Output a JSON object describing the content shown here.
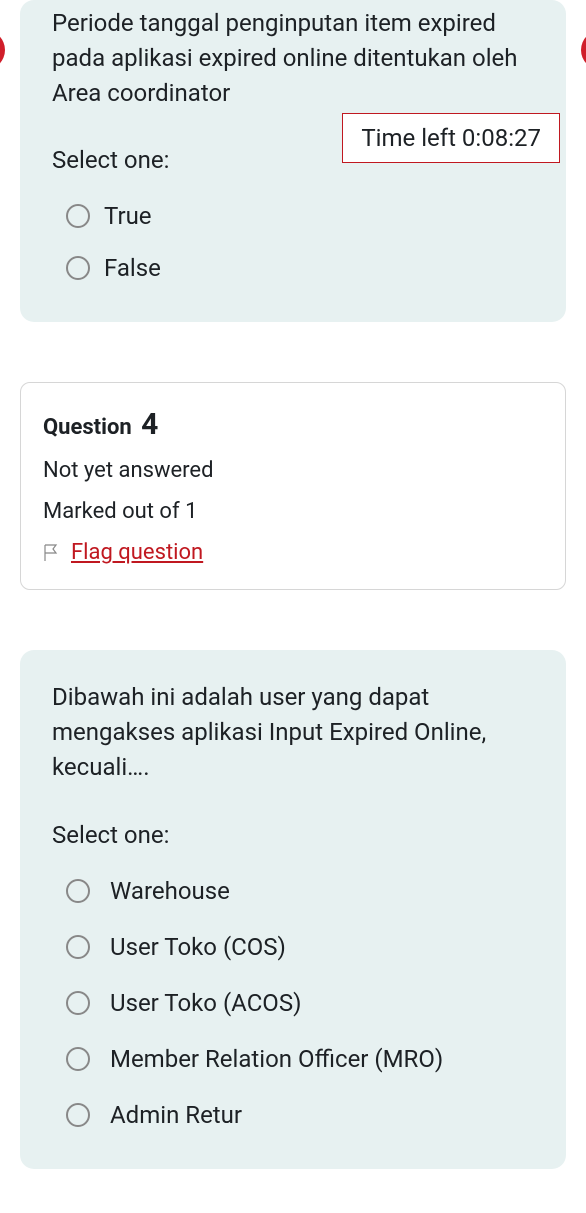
{
  "timer": {
    "label": "Time left 0:08:27"
  },
  "question_a": {
    "text": "Periode tanggal penginputan item expired pada aplikasi expired online ditentukan oleh Area coordinator",
    "select_one": "Select one:",
    "options": [
      {
        "label": "True"
      },
      {
        "label": "False"
      }
    ]
  },
  "info": {
    "question_word": "Question",
    "number": "4",
    "status": "Not yet answered",
    "marks": "Marked out of 1",
    "flag": "Flag question"
  },
  "question_b": {
    "text": "Dibawah ini adalah user yang dapat mengakses aplikasi Input Expired Online, kecuali….",
    "select_one": "Select one:",
    "options": [
      {
        "label": "Warehouse"
      },
      {
        "label": "User Toko (COS)"
      },
      {
        "label": "User Toko (ACOS)"
      },
      {
        "label": "Member Relation Officer (MRO)"
      },
      {
        "label": "Admin Retur"
      }
    ]
  }
}
